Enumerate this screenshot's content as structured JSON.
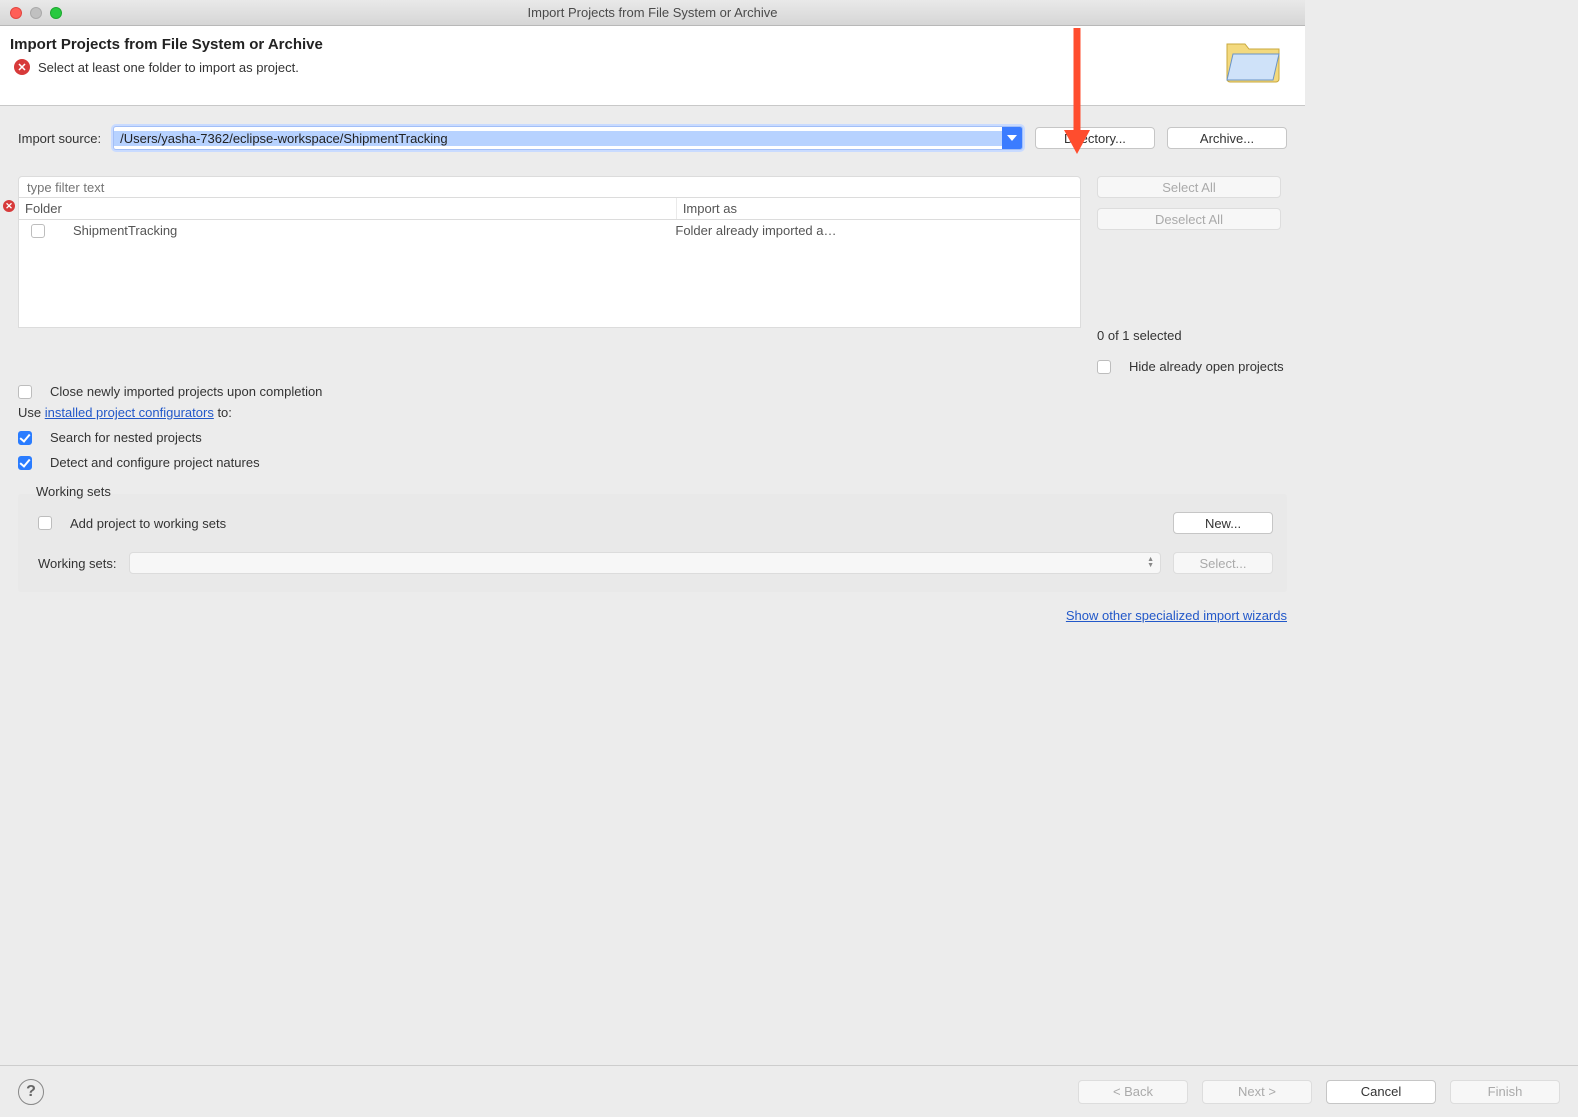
{
  "window": {
    "title": "Import Projects from File System or Archive"
  },
  "banner": {
    "title": "Import Projects from File System or Archive",
    "message": "Select at least one folder to import as project."
  },
  "importSource": {
    "label": "Import source:",
    "value": "/Users/yasha-7362/eclipse-workspace/ShipmentTracking",
    "directory_btn": "Directory...",
    "archive_btn": "Archive..."
  },
  "filter": {
    "placeholder": "type filter text"
  },
  "table": {
    "headers": {
      "folder": "Folder",
      "importas": "Import as"
    },
    "rows": [
      {
        "folder": "ShipmentTracking",
        "importas": "Folder already imported a…",
        "checked": false
      }
    ]
  },
  "rightPanel": {
    "select_all": "Select All",
    "deselect_all": "Deselect All",
    "selection_text": "0 of 1 selected",
    "hide_open": "Hide already open projects",
    "hide_open_checked": false
  },
  "options": {
    "close_new": {
      "label": "Close newly imported projects upon completion",
      "checked": false
    },
    "use_prefix": "Use ",
    "use_link": "installed project configurators",
    "use_suffix": " to:",
    "search_nested": {
      "label": "Search for nested projects",
      "checked": true
    },
    "detect_natures": {
      "label": "Detect and configure project natures",
      "checked": true
    }
  },
  "workingSets": {
    "legend": "Working sets",
    "add": {
      "label": "Add project to working sets",
      "checked": false
    },
    "new_btn": "New...",
    "ws_label": "Working sets:",
    "select_btn": "Select..."
  },
  "footerLink": "Show other specialized import wizards",
  "buttons": {
    "back": "< Back",
    "next": "Next >",
    "cancel": "Cancel",
    "finish": "Finish"
  }
}
